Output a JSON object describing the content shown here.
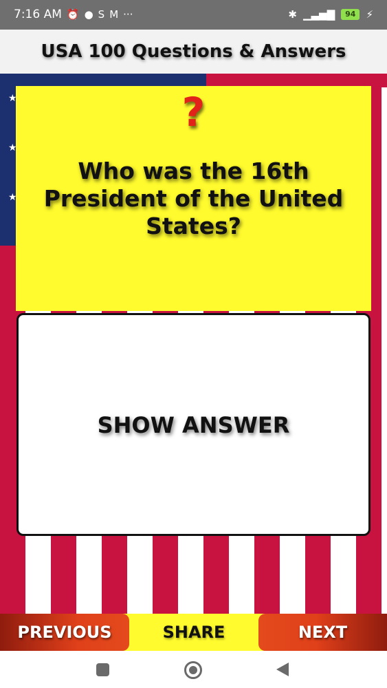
{
  "status_bar": {
    "time": "7:16 AM",
    "battery": "94",
    "icons": [
      "alarm-icon",
      "chat-icon",
      "s-icon",
      "gmail-icon",
      "more-icon",
      "bluetooth-icon",
      "signal-icon",
      "battery-icon",
      "charging-icon"
    ],
    "overflow_dots": "···"
  },
  "app_bar": {
    "title": "USA 100 Questions & Answers"
  },
  "question": {
    "symbol": "?",
    "text": "Who was the 16th President of the United States?"
  },
  "answer": {
    "button_label": "SHOW ANSWER"
  },
  "bottom_nav": {
    "previous_label": "PREVIOUS",
    "share_label": "SHARE",
    "next_label": "NEXT"
  },
  "colors": {
    "card_yellow": "#fffb2e",
    "flag_red": "#c8123f",
    "flag_blue": "#1c2f6e",
    "button_orange": "#e0401a"
  }
}
